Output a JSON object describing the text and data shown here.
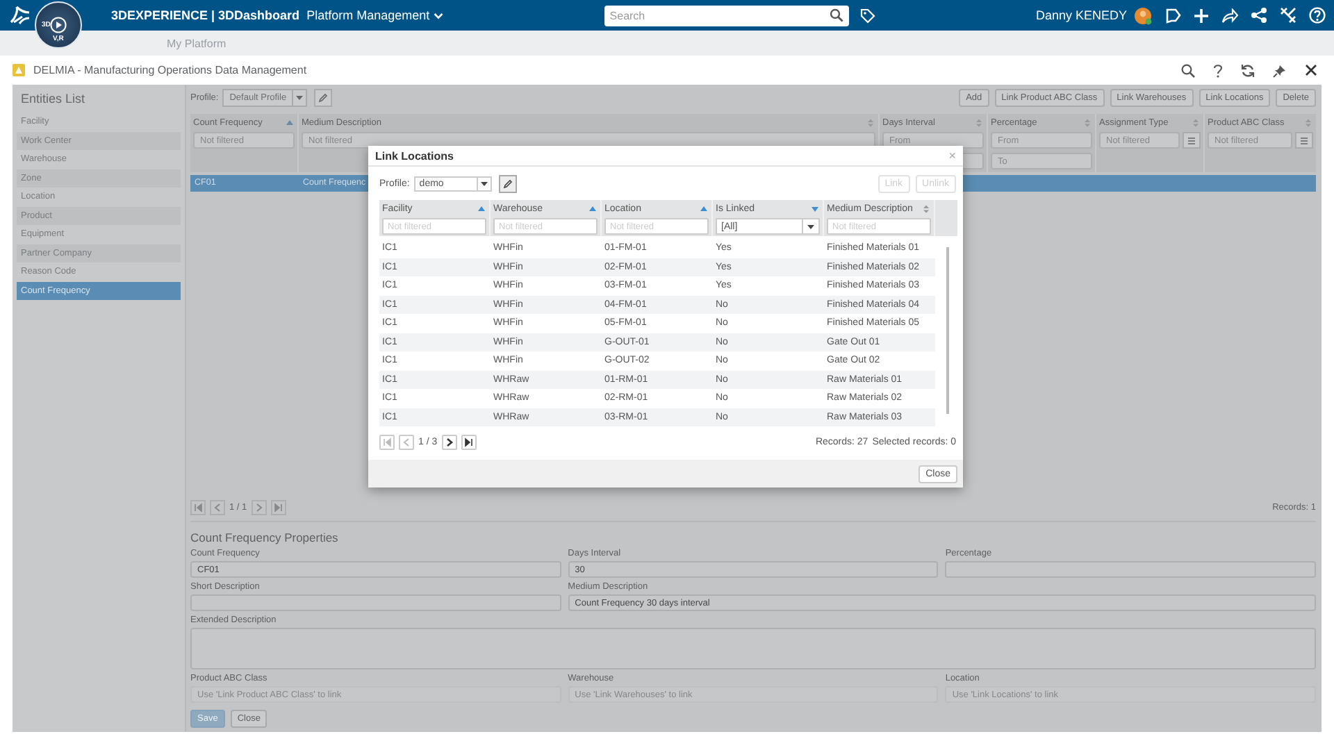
{
  "top_bar": {
    "brand": "3DEXPERIENCE | 3DDashboard",
    "app": "Platform Management",
    "compass": [
      "3D",
      "V,R"
    ],
    "search": {
      "placeholder": "Search"
    },
    "user": "Danny KENEDY"
  },
  "tab_bar": {
    "tabs": [
      {
        "label": "My Platform"
      }
    ]
  },
  "app_header": {
    "title": "DELMIA - Manufacturing Operations Data Management"
  },
  "entities": {
    "title": "Entities List",
    "items": [
      {
        "label": "Facility",
        "selected": false
      },
      {
        "label": "Work Center",
        "selected": false
      },
      {
        "label": "Warehouse",
        "selected": false
      },
      {
        "label": "Zone",
        "selected": false
      },
      {
        "label": "Location",
        "selected": false
      },
      {
        "label": "Product",
        "selected": false
      },
      {
        "label": "Equipment",
        "selected": false
      },
      {
        "label": "Partner Company",
        "selected": false
      },
      {
        "label": "Reason Code",
        "selected": false
      },
      {
        "label": "Count Frequency",
        "selected": true
      }
    ]
  },
  "grid": {
    "profile_label": "Profile:",
    "profile": "Default Profile",
    "buttons": [
      "Add",
      "Link Product ABC Class",
      "Link Warehouses",
      "Link Locations",
      "Delete"
    ],
    "columns": [
      {
        "label": "Count Frequency",
        "sort_ascending": true,
        "sort_descending": false,
        "filter": {
          "kind": "text",
          "placeholder": "Not filtered"
        }
      },
      {
        "label": "Medium Description",
        "sort_ascending": false,
        "sort_descending": false,
        "filter": {
          "kind": "text",
          "placeholder": "Not filtered"
        }
      },
      {
        "label": "Days Interval",
        "sort_ascending": false,
        "sort_descending": false,
        "filter": {
          "kind": "range",
          "placeholder": "From"
        }
      },
      {
        "label": "Percentage",
        "sort_ascending": false,
        "sort_descending": false,
        "filter": {
          "kind": "range",
          "placeholder": "From",
          "placeholder_to": "To"
        }
      },
      {
        "label": "Assignment Type",
        "sort_ascending": false,
        "sort_descending": false,
        "filter": {
          "kind": "list",
          "placeholder": "Not filtered"
        }
      },
      {
        "label": "Product ABC Class",
        "sort_ascending": false,
        "sort_descending": false,
        "filter": {
          "kind": "list",
          "placeholder": "Not filtered"
        }
      }
    ],
    "rows": [
      {
        "cells": [
          "CF01",
          "Count Frequenc"
        ],
        "selected": true
      }
    ],
    "pager": {
      "page": "1 / 1",
      "records": "Records: 1"
    }
  },
  "properties": {
    "title": "Count Frequency Properties",
    "fields": [
      {
        "kind": "field",
        "label": "Count Frequency",
        "value": "CF01"
      },
      {
        "kind": "field",
        "label": "Days Interval",
        "value": "30"
      },
      {
        "kind": "field",
        "label": "Percentage"
      },
      {
        "kind": "field",
        "label": "Short Description"
      },
      {
        "kind": "wide",
        "label": "Medium Description",
        "value": "Count Frequency 30 days interval"
      },
      {
        "kind": "textarea",
        "label": "Extended Description"
      },
      {
        "kind": "field",
        "label": "Product ABC Class",
        "placeholder": "Use 'Link Product ABC Class' to link"
      },
      {
        "kind": "field",
        "label": "Warehouse",
        "placeholder": "Use 'Link Warehouses' to link"
      },
      {
        "kind": "field",
        "label": "Location",
        "placeholder": "Use 'Link Locations' to link"
      }
    ],
    "buttons": [
      {
        "label": "Save",
        "disabled": true
      },
      {
        "label": "Close",
        "disabled": false
      }
    ]
  },
  "dialog": {
    "title": "Link Locations",
    "close_glyph": "×",
    "profile_label": "Profile:",
    "profile": "demo",
    "buttons": [
      {
        "label": "Link",
        "disabled": true
      },
      {
        "label": "Unlink",
        "disabled": true
      }
    ],
    "columns": [
      {
        "label": "Facility",
        "sort_ascending": true,
        "sort_descending": false,
        "filter": {
          "kind": "text",
          "placeholder": "Not filtered"
        }
      },
      {
        "label": "Warehouse",
        "sort_ascending": true,
        "sort_descending": false,
        "filter": {
          "kind": "text",
          "placeholder": "Not filtered"
        }
      },
      {
        "label": "Location",
        "sort_ascending": true,
        "sort_descending": false,
        "filter": {
          "kind": "text",
          "placeholder": "Not filtered"
        }
      },
      {
        "label": "Is Linked",
        "sort_ascending": false,
        "sort_descending": true,
        "filter": {
          "kind": "select",
          "value": "[All]"
        }
      },
      {
        "label": "Medium Description",
        "sort_ascending": false,
        "sort_descending": false,
        "filter": {
          "kind": "text",
          "placeholder": "Not filtered"
        }
      }
    ],
    "rows": [
      [
        "IC1",
        "WHFin",
        "01-FM-01",
        "Yes",
        "Finished Materials 01"
      ],
      [
        "IC1",
        "WHFin",
        "02-FM-01",
        "Yes",
        "Finished Materials 02"
      ],
      [
        "IC1",
        "WHFin",
        "03-FM-01",
        "Yes",
        "Finished Materials 03"
      ],
      [
        "IC1",
        "WHFin",
        "04-FM-01",
        "No",
        "Finished Materials 04"
      ],
      [
        "IC1",
        "WHFin",
        "05-FM-01",
        "No",
        "Finished Materials 05"
      ],
      [
        "IC1",
        "WHFin",
        "G-OUT-01",
        "No",
        "Gate Out 01"
      ],
      [
        "IC1",
        "WHFin",
        "G-OUT-02",
        "No",
        "Gate Out 02"
      ],
      [
        "IC1",
        "WHRaw",
        "01-RM-01",
        "No",
        "Raw Materials 01"
      ],
      [
        "IC1",
        "WHRaw",
        "02-RM-01",
        "No",
        "Raw Materials 02"
      ],
      [
        "IC1",
        "WHRaw",
        "03-RM-01",
        "No",
        "Raw Materials 03"
      ]
    ],
    "pager": {
      "page": "1 / 3",
      "records": "Records: 27",
      "selected": "Selected records: 0"
    },
    "close": "Close"
  }
}
